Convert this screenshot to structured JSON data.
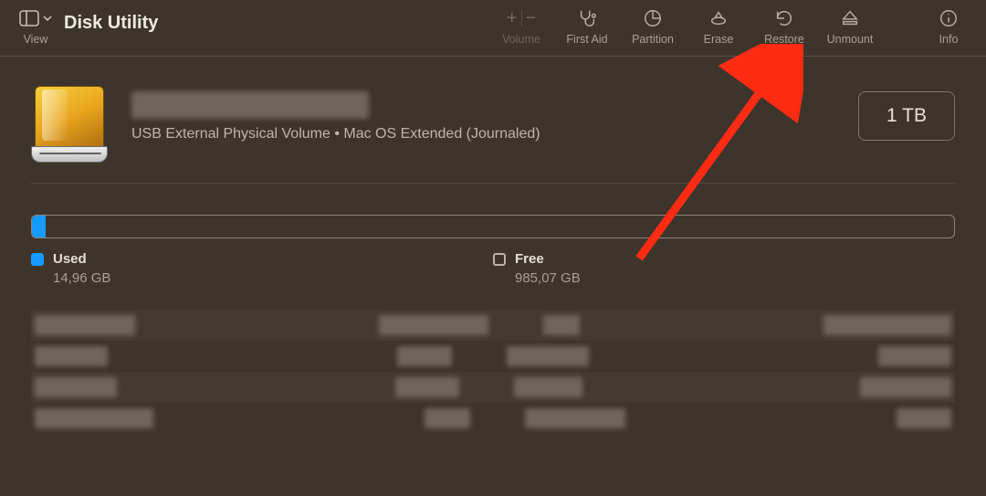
{
  "toolbar": {
    "view_label": "View",
    "app_title": "Disk Utility",
    "volume_label": "Volume",
    "first_aid_label": "First Aid",
    "partition_label": "Partition",
    "erase_label": "Erase",
    "restore_label": "Restore",
    "unmount_label": "Unmount",
    "info_label": "Info"
  },
  "volume": {
    "subtitle": "USB External Physical Volume",
    "format": "Mac OS Extended (Journaled)",
    "capacity": "1 TB"
  },
  "usage": {
    "used_label": "Used",
    "used_value": "14,96 GB",
    "free_label": "Free",
    "free_value": "985,07 GB",
    "used_percent": 1.5
  }
}
